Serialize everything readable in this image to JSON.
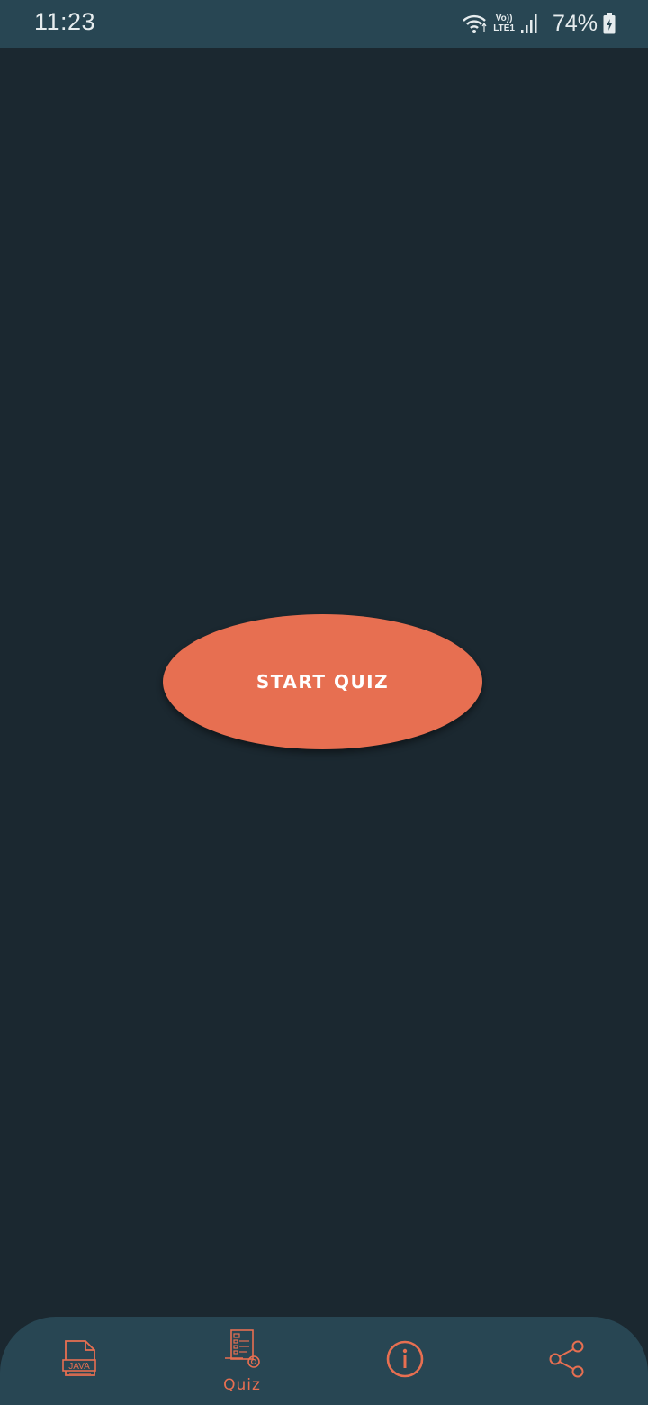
{
  "status_bar": {
    "time": "11:23",
    "network_top": "Vo))",
    "network_bottom": "LTE1",
    "battery": "74%",
    "icons": [
      "wifi-icon",
      "signal-icon",
      "battery-charging-icon"
    ]
  },
  "main": {
    "start_button_label": "START QUIZ"
  },
  "bottom_nav": {
    "items": [
      {
        "icon": "java-file-icon",
        "icon_text": "JAVA",
        "label": ""
      },
      {
        "icon": "quiz-document-icon",
        "label": "Quiz"
      },
      {
        "icon": "info-icon",
        "label": ""
      },
      {
        "icon": "share-icon",
        "label": ""
      }
    ]
  },
  "colors": {
    "background": "#1b2830",
    "bars": "#284653",
    "accent": "#e76f51",
    "status_text": "#e6ecee"
  }
}
